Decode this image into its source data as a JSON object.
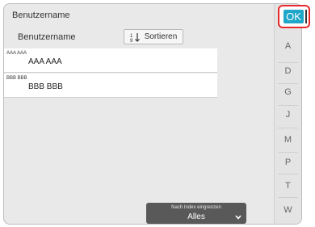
{
  "title": "Benutzername",
  "column_header": "Benutzername",
  "sort_button": {
    "label": "Sortieren",
    "icon": "sort-icon"
  },
  "entries": [
    {
      "small": "AAA AAA",
      "main": "AAA AAA"
    },
    {
      "small": "BBB BBB",
      "main": "BBB BBB"
    }
  ],
  "ok_button": {
    "label": "OK"
  },
  "index_letters": [
    "A",
    "D",
    "G",
    "J",
    "M",
    "P",
    "T",
    "W"
  ],
  "filter": {
    "label": "Nach Index eingrenzen",
    "value": "Alles"
  },
  "colors": {
    "ok_button": "#1ea7c8",
    "highlight": "#e8282d",
    "filter_bg": "#595959"
  }
}
